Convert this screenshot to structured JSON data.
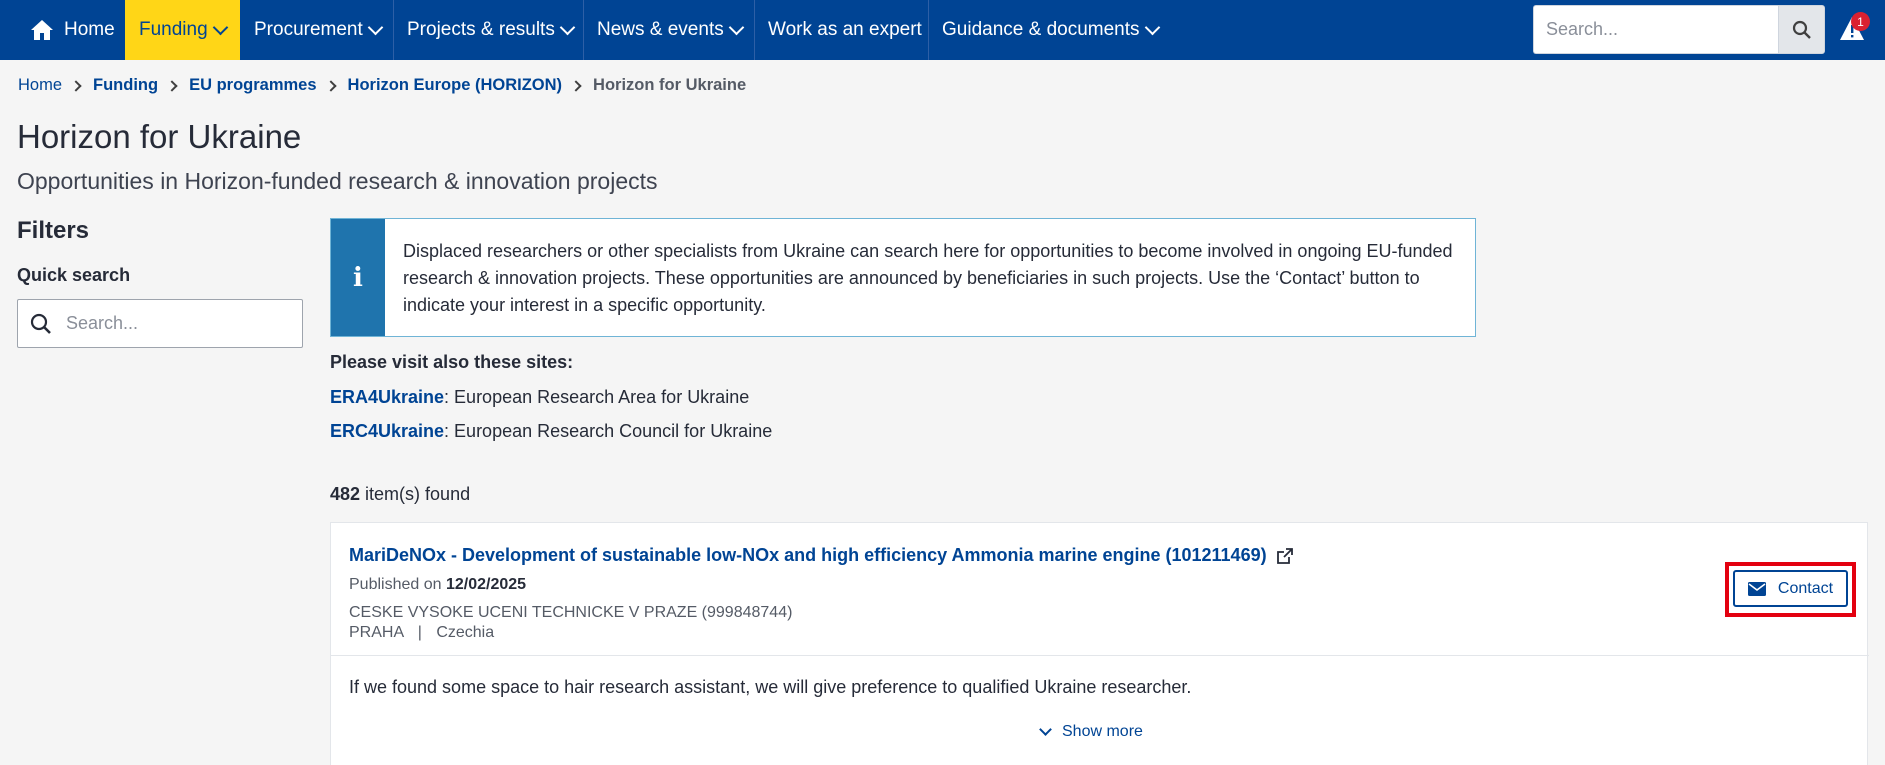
{
  "nav": {
    "home": "Home",
    "items": [
      {
        "label": "Funding",
        "active": true
      },
      {
        "label": "Procurement"
      },
      {
        "label": "Projects & results"
      },
      {
        "label": "News & events"
      },
      {
        "label": "Work as an expert"
      },
      {
        "label": "Guidance & documents"
      }
    ],
    "search_placeholder": "Search...",
    "alert_count": "1",
    "colors": {
      "nav_bg": "#004494",
      "active_bg": "#ffd617",
      "badge": "#da2131"
    }
  },
  "breadcrumb": {
    "items": [
      "Home",
      "Funding",
      "EU programmes",
      "Horizon Europe (HORIZON)"
    ],
    "current": "Horizon for Ukraine"
  },
  "page": {
    "title": "Horizon for Ukraine",
    "subtitle": "Opportunities in Horizon-funded research & innovation projects"
  },
  "filters": {
    "title": "Filters",
    "quick_search_label": "Quick search",
    "quick_search_placeholder": "Search..."
  },
  "info": {
    "icon": "i",
    "line1": "Displaced researchers or other specialists from Ukraine can search here for opportunities to become involved in ongoing EU-funded",
    "line2": "research & innovation projects. These opportunities are announced by beneficiaries in such projects. Use the ‘Contact’ button to",
    "line3": "indicate your interest in a specific opportunity."
  },
  "visit": {
    "title": "Please visit also these sites:",
    "sites": [
      {
        "link": "ERA4Ukraine",
        "desc": ": European Research Area for Ukraine"
      },
      {
        "link": "ERC4Ukraine",
        "desc": ": European Research Council for Ukraine"
      }
    ]
  },
  "results": {
    "count": "482",
    "suffix": " item(s) found"
  },
  "card": {
    "title": "MariDeNOx - Development of sustainable low-NOx and high efficiency Ammonia marine engine (101211469)",
    "published_prefix": "Published on ",
    "published_date": "12/02/2025",
    "organisation": "CESKE VYSOKE UCENI TECHNICKE V PRAZE (999848744)",
    "city": "PRAHA",
    "separator": "|",
    "country": "Czechia",
    "contact_label": "Contact",
    "description": "If we found some space to hair research assistant, we will give preference to qualified Ukraine researcher.",
    "show_more": "Show more"
  }
}
